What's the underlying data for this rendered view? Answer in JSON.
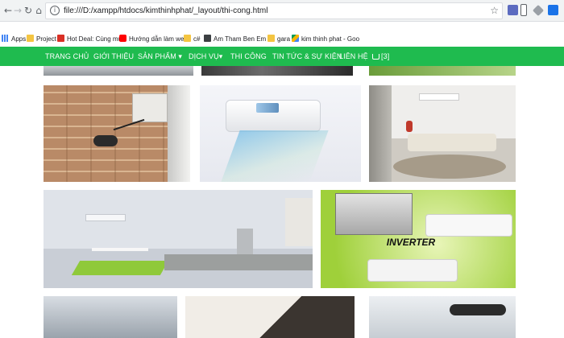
{
  "browser": {
    "url": "file:///D:/xampp/htdocs/kimthinhphat/_layout/thi-cong.html"
  },
  "bookmarks": [
    {
      "label": "Apps",
      "icon": "apps-grid-icon"
    },
    {
      "label": "Project",
      "icon": "folder-icon"
    },
    {
      "label": "Hot Deal: Cùng mua",
      "icon": "hotdeal-favicon"
    },
    {
      "label": "Hướng dẫn làm webs",
      "icon": "youtube-favicon"
    },
    {
      "label": "c#",
      "icon": "folder-icon"
    },
    {
      "label": "Am Tham Ben Em Ta",
      "icon": "music-favicon"
    },
    {
      "label": "gara",
      "icon": "folder-icon"
    },
    {
      "label": "kim thinh phat - Goo",
      "icon": "google-drive-favicon"
    }
  ],
  "menu": [
    {
      "label": "TRANG CHỦ"
    },
    {
      "label": "GIỚI THIỆU"
    },
    {
      "label": "SẢN PHẨM ▾"
    },
    {
      "label": "DỊCH VỤ▾"
    },
    {
      "label": "THI CÔNG"
    },
    {
      "label": "TIN TỨC & SỰ KIỆN"
    },
    {
      "label": "LIÊN HỆ"
    },
    {
      "label": "[3]"
    }
  ],
  "gallery": {
    "watermark": "INVERTER"
  },
  "colors": {
    "nav_green": "#1fbb4f",
    "toolbar": "#f1f3f4"
  }
}
